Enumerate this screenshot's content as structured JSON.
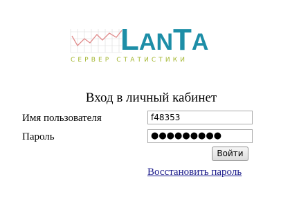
{
  "logo": {
    "brand_big_1": "L",
    "brand_small_1": "AN",
    "brand_big_2": "T",
    "brand_small_2": "A",
    "subtitle": "СЕРВЕР СТАТИСТИКИ",
    "brand_color": "#1d8ea7",
    "subtitle_color": "#a2b52b",
    "graph_color": "#e08a8a"
  },
  "login": {
    "title": "Вход в личный кабинет",
    "username_label": "Имя пользователя",
    "username_value": "f48353",
    "password_label": "Пароль",
    "password_value": "●●●●●●●●●",
    "submit_label": "Войти",
    "recover_link": "Восстановить пароль"
  }
}
